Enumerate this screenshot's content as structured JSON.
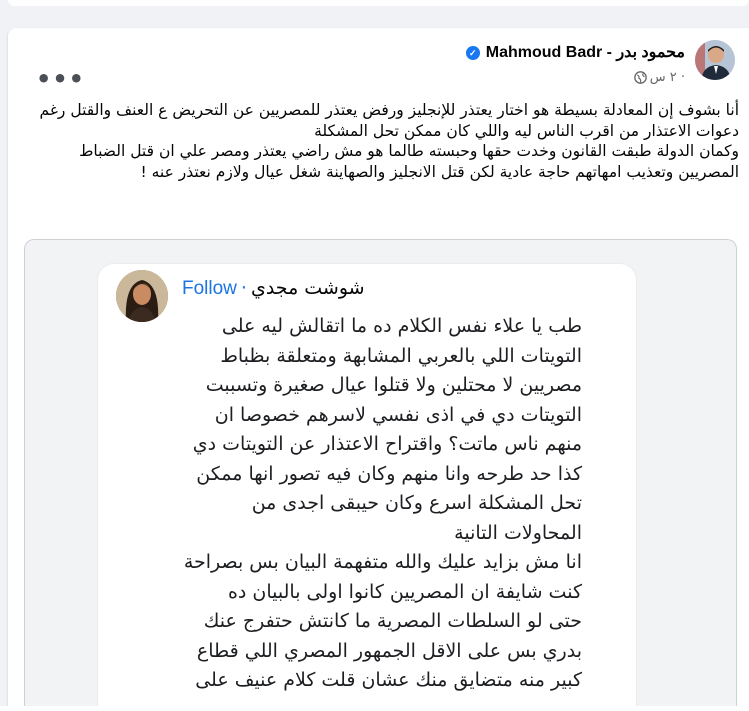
{
  "post": {
    "author": "Mahmoud Badr - محمود بدر",
    "time": "٢ س ·",
    "paragraphs": [
      "أنا بشوف إن المعادلة بسيطة هو اختار يعتذر للإنجليز ورفض يعتذر للمصريين عن التحريض ع العنف والقتل رغم دعوات الاعتذار من اقرب الناس ليه واللي كان ممكن تحل المشكلة",
      "وكمان الدولة طبقت القانون وخدت حقها وحبسته طالما هو مش راضي يعتذر ومصر علي ان قتل الضباط المصريين وتعذيب امهاتهم حاجة عادية لكن قتل الانجليز والصهاينة شغل عيال ولازم نعتذر عنه !"
    ]
  },
  "shared": {
    "follow_label": "Follow",
    "separator": "·",
    "name": "شوشت مجدي",
    "paragraphs": [
      "طب يا علاء نفس الكلام ده ما اتقالش ليه على التويتات اللي بالعربي المشابهة ومتعلقة بظباط مصريين لا محتلين ولا قتلوا عيال صغيرة وتسببت التويتات دي في اذى نفسي لاسرهم خصوصا ان منهم ناس ماتت؟ واقتراح الاعتذار عن التويتات دي كذا حد طرحه وانا منهم وكان فيه تصور انها ممكن تحل المشكلة اسرع وكان حيبقى اجدى من المحاولات التانية",
      "انا مش بزايد عليك والله متفهمة البيان بس بصراحة كنت شايفة ان المصريين كانوا اولى بالبيان ده",
      "حتى لو السلطات المصرية ما كانتش حتفرج عنك بدري بس على الاقل الجمهور المصري اللي قطاع كبير منه متضايق منك عشان قلت كلام عنيف على"
    ]
  },
  "icons": {
    "verified": "verified-badge-icon",
    "audience": "globe-icon",
    "more": "more-options-icon"
  },
  "colors": {
    "accent": "#1877f2",
    "follow": "#1b74e4",
    "background": "#f0f2f5",
    "secondary_text": "#65676b"
  }
}
